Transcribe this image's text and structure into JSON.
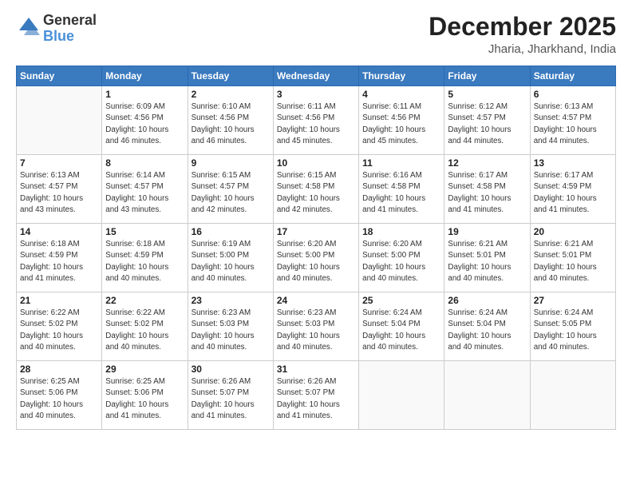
{
  "header": {
    "logo_general": "General",
    "logo_blue": "Blue",
    "month": "December 2025",
    "location": "Jharia, Jharkhand, India"
  },
  "weekdays": [
    "Sunday",
    "Monday",
    "Tuesday",
    "Wednesday",
    "Thursday",
    "Friday",
    "Saturday"
  ],
  "weeks": [
    [
      {
        "day": "",
        "info": ""
      },
      {
        "day": "1",
        "info": "Sunrise: 6:09 AM\nSunset: 4:56 PM\nDaylight: 10 hours\nand 46 minutes."
      },
      {
        "day": "2",
        "info": "Sunrise: 6:10 AM\nSunset: 4:56 PM\nDaylight: 10 hours\nand 46 minutes."
      },
      {
        "day": "3",
        "info": "Sunrise: 6:11 AM\nSunset: 4:56 PM\nDaylight: 10 hours\nand 45 minutes."
      },
      {
        "day": "4",
        "info": "Sunrise: 6:11 AM\nSunset: 4:56 PM\nDaylight: 10 hours\nand 45 minutes."
      },
      {
        "day": "5",
        "info": "Sunrise: 6:12 AM\nSunset: 4:57 PM\nDaylight: 10 hours\nand 44 minutes."
      },
      {
        "day": "6",
        "info": "Sunrise: 6:13 AM\nSunset: 4:57 PM\nDaylight: 10 hours\nand 44 minutes."
      }
    ],
    [
      {
        "day": "7",
        "info": "Sunrise: 6:13 AM\nSunset: 4:57 PM\nDaylight: 10 hours\nand 43 minutes."
      },
      {
        "day": "8",
        "info": "Sunrise: 6:14 AM\nSunset: 4:57 PM\nDaylight: 10 hours\nand 43 minutes."
      },
      {
        "day": "9",
        "info": "Sunrise: 6:15 AM\nSunset: 4:57 PM\nDaylight: 10 hours\nand 42 minutes."
      },
      {
        "day": "10",
        "info": "Sunrise: 6:15 AM\nSunset: 4:58 PM\nDaylight: 10 hours\nand 42 minutes."
      },
      {
        "day": "11",
        "info": "Sunrise: 6:16 AM\nSunset: 4:58 PM\nDaylight: 10 hours\nand 41 minutes."
      },
      {
        "day": "12",
        "info": "Sunrise: 6:17 AM\nSunset: 4:58 PM\nDaylight: 10 hours\nand 41 minutes."
      },
      {
        "day": "13",
        "info": "Sunrise: 6:17 AM\nSunset: 4:59 PM\nDaylight: 10 hours\nand 41 minutes."
      }
    ],
    [
      {
        "day": "14",
        "info": "Sunrise: 6:18 AM\nSunset: 4:59 PM\nDaylight: 10 hours\nand 41 minutes."
      },
      {
        "day": "15",
        "info": "Sunrise: 6:18 AM\nSunset: 4:59 PM\nDaylight: 10 hours\nand 40 minutes."
      },
      {
        "day": "16",
        "info": "Sunrise: 6:19 AM\nSunset: 5:00 PM\nDaylight: 10 hours\nand 40 minutes."
      },
      {
        "day": "17",
        "info": "Sunrise: 6:20 AM\nSunset: 5:00 PM\nDaylight: 10 hours\nand 40 minutes."
      },
      {
        "day": "18",
        "info": "Sunrise: 6:20 AM\nSunset: 5:00 PM\nDaylight: 10 hours\nand 40 minutes."
      },
      {
        "day": "19",
        "info": "Sunrise: 6:21 AM\nSunset: 5:01 PM\nDaylight: 10 hours\nand 40 minutes."
      },
      {
        "day": "20",
        "info": "Sunrise: 6:21 AM\nSunset: 5:01 PM\nDaylight: 10 hours\nand 40 minutes."
      }
    ],
    [
      {
        "day": "21",
        "info": "Sunrise: 6:22 AM\nSunset: 5:02 PM\nDaylight: 10 hours\nand 40 minutes."
      },
      {
        "day": "22",
        "info": "Sunrise: 6:22 AM\nSunset: 5:02 PM\nDaylight: 10 hours\nand 40 minutes."
      },
      {
        "day": "23",
        "info": "Sunrise: 6:23 AM\nSunset: 5:03 PM\nDaylight: 10 hours\nand 40 minutes."
      },
      {
        "day": "24",
        "info": "Sunrise: 6:23 AM\nSunset: 5:03 PM\nDaylight: 10 hours\nand 40 minutes."
      },
      {
        "day": "25",
        "info": "Sunrise: 6:24 AM\nSunset: 5:04 PM\nDaylight: 10 hours\nand 40 minutes."
      },
      {
        "day": "26",
        "info": "Sunrise: 6:24 AM\nSunset: 5:04 PM\nDaylight: 10 hours\nand 40 minutes."
      },
      {
        "day": "27",
        "info": "Sunrise: 6:24 AM\nSunset: 5:05 PM\nDaylight: 10 hours\nand 40 minutes."
      }
    ],
    [
      {
        "day": "28",
        "info": "Sunrise: 6:25 AM\nSunset: 5:06 PM\nDaylight: 10 hours\nand 40 minutes."
      },
      {
        "day": "29",
        "info": "Sunrise: 6:25 AM\nSunset: 5:06 PM\nDaylight: 10 hours\nand 41 minutes."
      },
      {
        "day": "30",
        "info": "Sunrise: 6:26 AM\nSunset: 5:07 PM\nDaylight: 10 hours\nand 41 minutes."
      },
      {
        "day": "31",
        "info": "Sunrise: 6:26 AM\nSunset: 5:07 PM\nDaylight: 10 hours\nand 41 minutes."
      },
      {
        "day": "",
        "info": ""
      },
      {
        "day": "",
        "info": ""
      },
      {
        "day": "",
        "info": ""
      }
    ]
  ]
}
